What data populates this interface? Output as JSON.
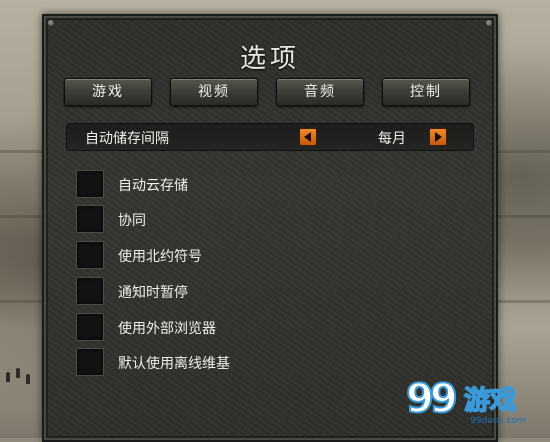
{
  "menu": {
    "title": "选项",
    "tabs": [
      {
        "label": "游戏"
      },
      {
        "label": "视频"
      },
      {
        "label": "音频"
      },
      {
        "label": "控制"
      }
    ]
  },
  "autosave": {
    "label": "自动储存间隔",
    "value": "每月"
  },
  "options": [
    {
      "label": "自动云存储",
      "checked": false
    },
    {
      "label": "协同",
      "checked": false
    },
    {
      "label": "使用北约符号",
      "checked": false
    },
    {
      "label": "通知时暂停",
      "checked": false
    },
    {
      "label": "使用外部浏览器",
      "checked": false
    },
    {
      "label": "默认使用离线维基",
      "checked": false
    }
  ],
  "watermark": {
    "number": "99",
    "text": "游戏",
    "url": "99danji.com"
  },
  "colors": {
    "arrow": "#e0761e",
    "panel": "#33342f",
    "watermark": "#3a9ad9"
  }
}
